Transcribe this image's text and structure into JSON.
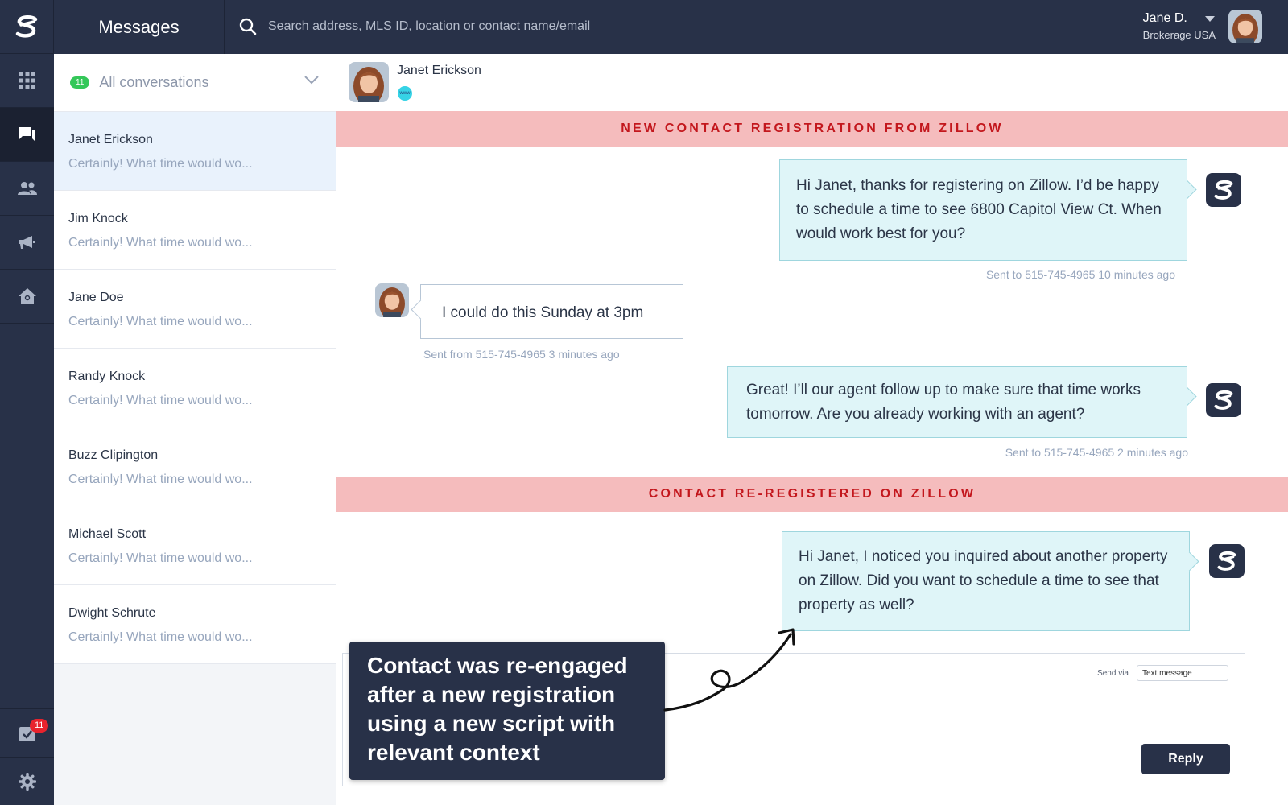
{
  "app": {
    "title": "Messages"
  },
  "search": {
    "placeholder": "Search address, MLS ID, location or contact name/email"
  },
  "user": {
    "name": "Jane D.",
    "org": "Brokerage USA"
  },
  "rail": {
    "tasks_badge": "11"
  },
  "list": {
    "filter_count": "11",
    "filter_label": "All conversations",
    "conversations": [
      {
        "name": "Janet Erickson",
        "preview": "Certainly! What time would wo..."
      },
      {
        "name": "Jim Knock",
        "preview": "Certainly! What time would wo..."
      },
      {
        "name": "Jane Doe",
        "preview": "Certainly! What time would wo..."
      },
      {
        "name": "Randy Knock",
        "preview": "Certainly! What time would wo..."
      },
      {
        "name": "Buzz Clipington",
        "preview": "Certainly! What time would wo..."
      },
      {
        "name": "Michael Scott",
        "preview": "Certainly! What time would wo..."
      },
      {
        "name": "Dwight Schrute",
        "preview": "Certainly! What time would wo..."
      }
    ]
  },
  "chat": {
    "contact_name": "Janet Erickson",
    "source_tag": "www",
    "banner1": "NEW CONTACT REGISTRATION FROM ZILLOW",
    "banner2": "CONTACT RE-REGISTERED ON ZILLOW",
    "messages": [
      {
        "text": "Hi Janet, thanks for registering on Zillow. I’d be happy to schedule a time to see 6800 Capitol View Ct. When would work best for you?",
        "meta": "Sent to 515-745-4965 10 minutes ago"
      },
      {
        "text": "I could do this Sunday at 3pm",
        "meta": "Sent from 515-745-4965 3 minutes ago"
      },
      {
        "text": "Great! I’ll our agent follow up to make sure that time works tomorrow. Are you already working with an agent?",
        "meta": "Sent to 515-745-4965 2 minutes ago"
      },
      {
        "text": "Hi Janet, I noticed you inquired about another property on Zillow. Did you want to schedule a time to see that property as well?",
        "meta": ""
      }
    ],
    "composer": {
      "send_via_label": "Send via",
      "send_via_value": "Text message",
      "reply_label": "Reply"
    }
  },
  "callout": {
    "text": "Contact was re-engaged after a new registration using a new script with relevant context"
  },
  "colors": {
    "navy": "#283148",
    "banner": "#f5bcbd",
    "banner_text": "#c3171d",
    "bubble": "#dff5f8",
    "green": "#34c759",
    "red_badge": "#e8232d"
  }
}
